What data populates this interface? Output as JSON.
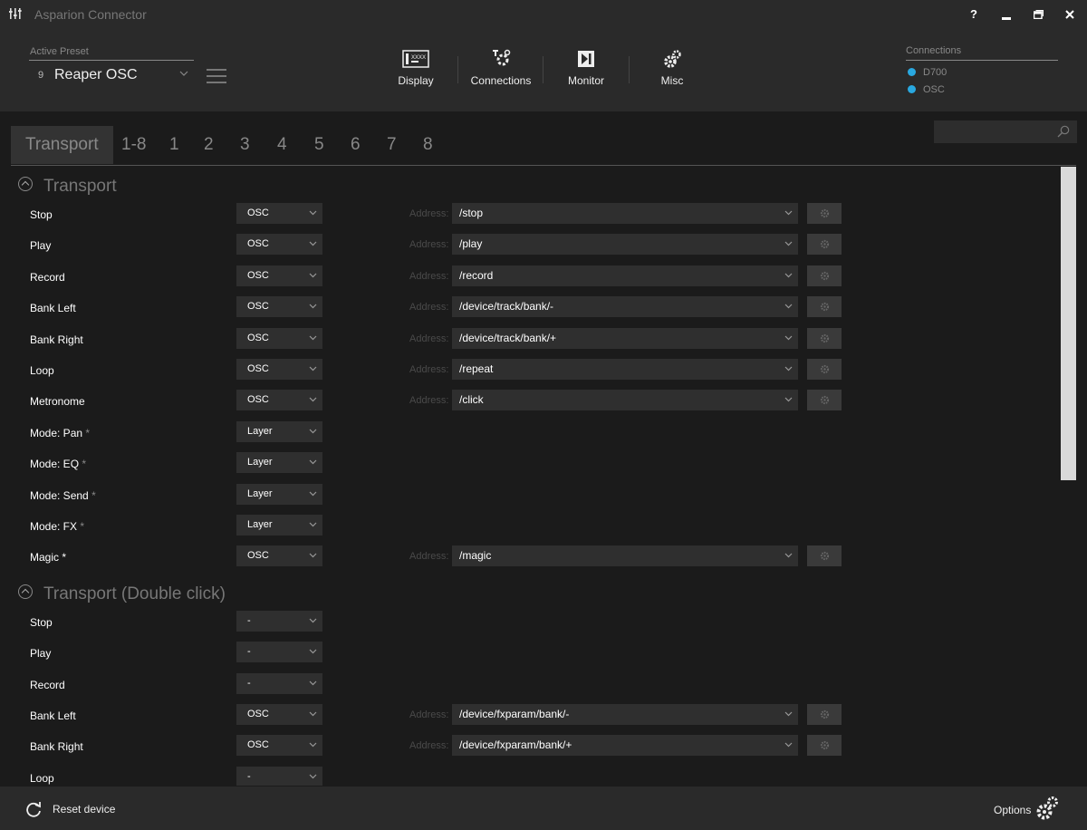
{
  "window": {
    "title": "Asparion Connector",
    "controls": {
      "help": "?",
      "minimize": "▁",
      "maximize": "▣",
      "close": "✕"
    }
  },
  "header": {
    "preset": {
      "label": "Active Preset",
      "number": "9",
      "name": "Reaper OSC"
    },
    "nav": [
      {
        "label": "Display",
        "icon": "display-icon"
      },
      {
        "label": "Connections",
        "icon": "connections-icon"
      },
      {
        "label": "Monitor",
        "icon": "monitor-icon"
      },
      {
        "label": "Misc",
        "icon": "misc-gear-icon"
      }
    ],
    "connections": {
      "label": "Connections",
      "items": [
        "D700",
        "OSC"
      ],
      "status_color": "#29a8e0"
    }
  },
  "tabs": [
    "Transport",
    "1-8",
    "1",
    "2",
    "3",
    "4",
    "5",
    "6",
    "7",
    "8"
  ],
  "search": {
    "placeholder": ""
  },
  "sections": [
    {
      "title": "Transport",
      "rows": [
        {
          "label": "Stop",
          "star": "",
          "type": "OSC",
          "address": "/stop"
        },
        {
          "label": "Play",
          "star": "",
          "type": "OSC",
          "address": "/play"
        },
        {
          "label": "Record",
          "star": "",
          "type": "OSC",
          "address": "/record"
        },
        {
          "label": "Bank Left",
          "star": "",
          "type": "OSC",
          "address": "/device/track/bank/-"
        },
        {
          "label": "Bank Right",
          "star": "",
          "type": "OSC",
          "address": "/device/track/bank/+"
        },
        {
          "label": "Loop",
          "star": "",
          "type": "OSC",
          "address": "/repeat"
        },
        {
          "label": "Metronome",
          "star": "",
          "type": "OSC",
          "address": "/click"
        },
        {
          "label": "Mode: Pan",
          "star": "*",
          "type": "Layer",
          "address": null
        },
        {
          "label": "Mode: EQ",
          "star": "*",
          "type": "Layer",
          "address": null
        },
        {
          "label": "Mode: Send",
          "star": "*",
          "type": "Layer",
          "address": null
        },
        {
          "label": "Mode: FX",
          "star": "*",
          "type": "Layer",
          "address": null
        },
        {
          "label": "Magic *",
          "star": "",
          "type": "OSC",
          "address": "/magic"
        }
      ]
    },
    {
      "title": "Transport (Double click)",
      "rows": [
        {
          "label": "Stop",
          "star": "",
          "type": "-",
          "address": null
        },
        {
          "label": "Play",
          "star": "",
          "type": "-",
          "address": null
        },
        {
          "label": "Record",
          "star": "",
          "type": "-",
          "address": null
        },
        {
          "label": "Bank Left",
          "star": "",
          "type": "OSC",
          "address": "/device/fxparam/bank/-"
        },
        {
          "label": "Bank Right",
          "star": "",
          "type": "OSC",
          "address": "/device/fxparam/bank/+"
        },
        {
          "label": "Loop",
          "star": "",
          "type": "-",
          "address": null
        }
      ]
    }
  ],
  "address_label": "Address:",
  "footer": {
    "reset": "Reset device",
    "options": "Options"
  }
}
